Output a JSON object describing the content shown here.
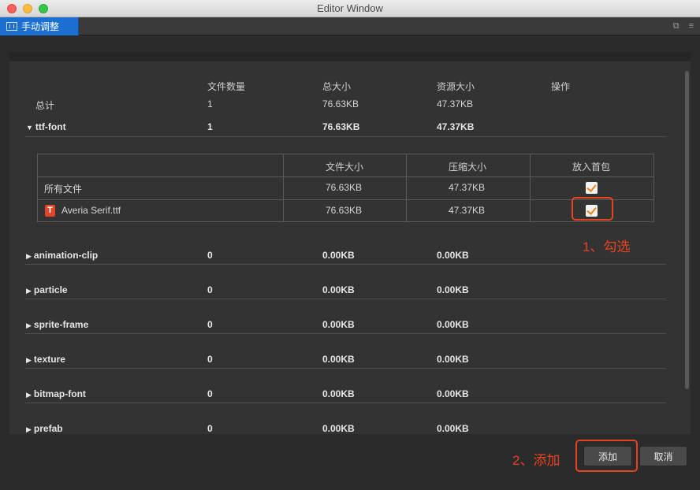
{
  "window": {
    "title": "Editor Window"
  },
  "tab": {
    "label": "手动调整"
  },
  "summary": {
    "headers": [
      "文件数量",
      "总大小",
      "资源大小",
      "操作"
    ],
    "total": {
      "label": "总计",
      "count": "1",
      "total_size": "76.63KB",
      "asset_size": "47.37KB"
    }
  },
  "groups": [
    {
      "name": "ttf-font",
      "count": "1",
      "total_size": "76.63KB",
      "asset_size": "47.37KB",
      "expanded": true
    },
    {
      "name": "animation-clip",
      "count": "0",
      "total_size": "0.00KB",
      "asset_size": "0.00KB",
      "expanded": false
    },
    {
      "name": "particle",
      "count": "0",
      "total_size": "0.00KB",
      "asset_size": "0.00KB",
      "expanded": false
    },
    {
      "name": "sprite-frame",
      "count": "0",
      "total_size": "0.00KB",
      "asset_size": "0.00KB",
      "expanded": false
    },
    {
      "name": "texture",
      "count": "0",
      "total_size": "0.00KB",
      "asset_size": "0.00KB",
      "expanded": false
    },
    {
      "name": "bitmap-font",
      "count": "0",
      "total_size": "0.00KB",
      "asset_size": "0.00KB",
      "expanded": false
    },
    {
      "name": "prefab",
      "count": "0",
      "total_size": "0.00KB",
      "asset_size": "0.00KB",
      "expanded": false
    }
  ],
  "detail": {
    "headers": [
      "文件大小",
      "压缩大小",
      "放入首包"
    ],
    "rows": [
      {
        "name": "所有文件",
        "file_size": "76.63KB",
        "compressed_size": "47.37KB",
        "checked": true
      },
      {
        "name": "Averia Serif.ttf",
        "file_size": "76.63KB",
        "compressed_size": "47.37KB",
        "checked": true,
        "icon": "font-file-icon",
        "icon_glyph": "T"
      }
    ]
  },
  "annotations": {
    "step1": "1、勾选",
    "step2": "2、添加",
    "color": "#e8431f"
  },
  "buttons": {
    "add": "添加",
    "cancel": "取消"
  },
  "colors": {
    "tab_accent": "#1a6fd1",
    "checkmark": "#e8861a"
  }
}
